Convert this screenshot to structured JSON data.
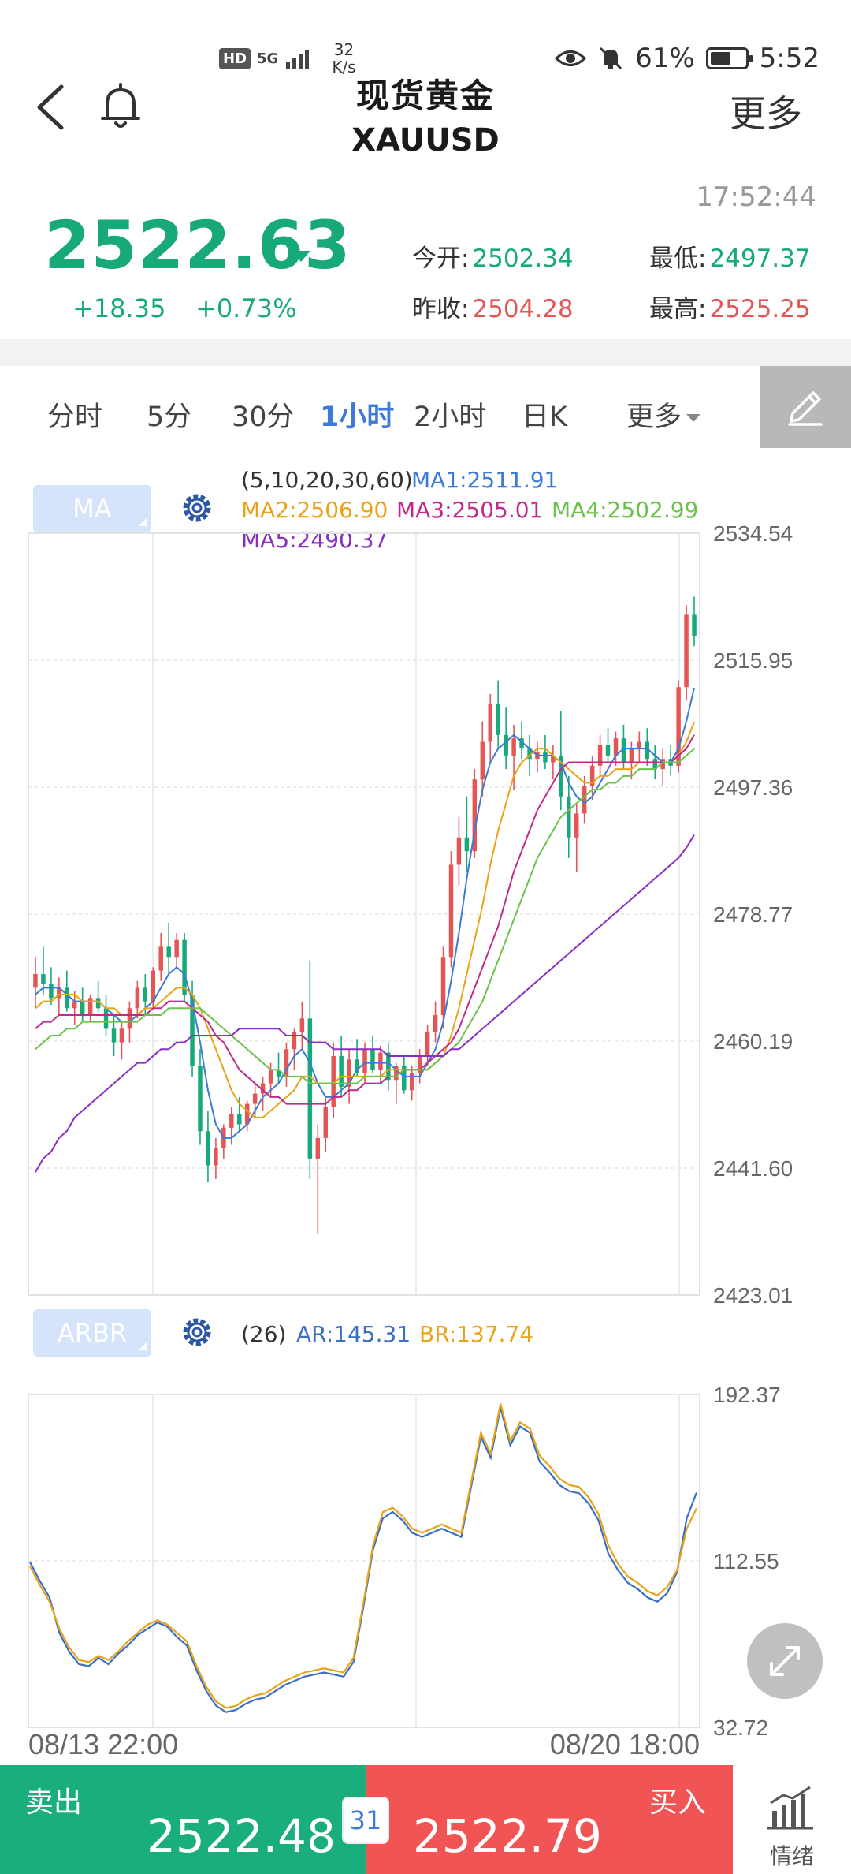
{
  "status_bar": {
    "hd": "HD",
    "network": "5G",
    "speed_value": "32",
    "speed_unit": "K/s",
    "battery": "61%",
    "battery_level": 0.61,
    "clock": "5:52"
  },
  "header": {
    "title": "现货黄金",
    "symbol": "XAUUSD",
    "more_label": "更多"
  },
  "quote": {
    "time": "17:52:44",
    "price": "2522.63",
    "change": "+18.35",
    "change_pct": "+0.73%",
    "open_label": "今开:",
    "open": "2502.34",
    "prev_close_label": "昨收:",
    "prev_close": "2504.28",
    "low_label": "最低:",
    "low": "2497.37",
    "high_label": "最高:",
    "high": "2525.25"
  },
  "tabs": [
    {
      "label": "分时",
      "active": false
    },
    {
      "label": "5分",
      "active": false
    },
    {
      "label": "30分",
      "active": false
    },
    {
      "label": "1小时",
      "active": true
    },
    {
      "label": "2小时",
      "active": false
    },
    {
      "label": "日K",
      "active": false
    },
    {
      "label": "更多",
      "active": false
    }
  ],
  "ma_panel": {
    "button": "MA",
    "params": "(5,10,20,30,60)",
    "ma1": "MA1:2511.91",
    "ma2": "MA2:2506.90",
    "ma3": "MA3:2505.01",
    "ma4": "MA4:2502.99",
    "ma5": "MA5:2490.37"
  },
  "arbr_panel": {
    "button": "ARBR",
    "params": "(26)",
    "ar": "AR:145.31",
    "br": "BR:137.74"
  },
  "x_labels": {
    "start": "08/13 22:00",
    "end": "08/20 18:00"
  },
  "trade": {
    "sell_label": "卖出",
    "sell_price": "2522.48",
    "spread": "31",
    "buy_label": "买入",
    "buy_price": "2522.79",
    "mood_label": "情绪"
  },
  "colors": {
    "up": "#e45555",
    "down": "#17a97a",
    "ma1": "#3b7ad6",
    "ma2": "#e8a317",
    "ma3": "#c2298a",
    "ma4": "#6cc24a",
    "ma5": "#8a2ec2",
    "ar": "#3b6fc4",
    "br": "#e8a317",
    "accent": "#3b7ad6"
  },
  "chart_data": [
    {
      "type": "candlestick",
      "title": "",
      "y_ticks": [
        "2534.54",
        "2515.95",
        "2497.36",
        "2478.77",
        "2460.19",
        "2441.60",
        "2423.01"
      ],
      "ylim": [
        2423.01,
        2534.54
      ],
      "grid": true,
      "candles": [
        [
          2468.0,
          2472.5,
          2465.0,
          2470.0
        ],
        [
          2470.0,
          2474.0,
          2467.0,
          2468.5
        ],
        [
          2468.5,
          2471.0,
          2465.5,
          2466.5
        ],
        [
          2466.5,
          2469.5,
          2464.0,
          2468.0
        ],
        [
          2468.0,
          2470.5,
          2464.5,
          2465.0
        ],
        [
          2465.0,
          2467.5,
          2462.5,
          2466.0
        ],
        [
          2466.0,
          2468.0,
          2463.0,
          2464.0
        ],
        [
          2464.0,
          2467.0,
          2463.0,
          2466.5
        ],
        [
          2466.5,
          2469.0,
          2464.5,
          2465.0
        ],
        [
          2465.0,
          2467.0,
          2461.0,
          2462.0
        ],
        [
          2462.0,
          2464.0,
          2458.0,
          2460.0
        ],
        [
          2460.0,
          2463.0,
          2457.5,
          2462.0
        ],
        [
          2462.0,
          2466.0,
          2460.0,
          2465.0
        ],
        [
          2465.0,
          2469.0,
          2463.5,
          2468.0
        ],
        [
          2468.0,
          2470.0,
          2464.0,
          2466.0
        ],
        [
          2466.0,
          2471.0,
          2465.0,
          2470.5
        ],
        [
          2470.5,
          2476.0,
          2469.0,
          2474.0
        ],
        [
          2474.0,
          2477.5,
          2470.0,
          2472.5
        ],
        [
          2472.5,
          2476.0,
          2471.0,
          2475.0
        ],
        [
          2475.0,
          2476.0,
          2466.0,
          2467.0
        ],
        [
          2467.0,
          2469.0,
          2455.0,
          2456.5
        ],
        [
          2456.5,
          2459.0,
          2445.0,
          2447.0
        ],
        [
          2447.0,
          2450.0,
          2439.5,
          2442.0
        ],
        [
          2442.0,
          2446.0,
          2440.0,
          2444.5
        ],
        [
          2444.5,
          2448.0,
          2443.0,
          2447.5
        ],
        [
          2447.5,
          2450.5,
          2445.0,
          2449.5
        ],
        [
          2449.5,
          2452.0,
          2447.0,
          2448.0
        ],
        [
          2448.0,
          2451.5,
          2447.0,
          2451.0
        ],
        [
          2451.0,
          2454.0,
          2449.0,
          2452.5
        ],
        [
          2452.5,
          2455.0,
          2450.0,
          2454.0
        ],
        [
          2454.0,
          2457.0,
          2452.0,
          2456.0
        ],
        [
          2456.0,
          2458.5,
          2454.0,
          2455.0
        ],
        [
          2455.0,
          2460.0,
          2453.5,
          2459.0
        ],
        [
          2459.0,
          2462.0,
          2456.0,
          2461.5
        ],
        [
          2461.5,
          2466.0,
          2459.0,
          2463.5
        ],
        [
          2463.5,
          2472.0,
          2440.0,
          2443.0
        ],
        [
          2443.0,
          2448.0,
          2432.0,
          2446.0
        ],
        [
          2446.0,
          2452.0,
          2444.0,
          2450.5
        ],
        [
          2450.5,
          2460.0,
          2449.0,
          2458.0
        ],
        [
          2458.0,
          2461.0,
          2452.0,
          2453.5
        ],
        [
          2453.5,
          2459.0,
          2451.0,
          2457.5
        ],
        [
          2457.5,
          2460.5,
          2455.0,
          2455.5
        ],
        [
          2455.5,
          2460.0,
          2454.0,
          2459.0
        ],
        [
          2459.0,
          2461.0,
          2455.5,
          2456.0
        ],
        [
          2456.0,
          2459.5,
          2454.0,
          2458.5
        ],
        [
          2458.5,
          2460.0,
          2453.0,
          2454.5
        ],
        [
          2454.5,
          2457.0,
          2451.0,
          2456.5
        ],
        [
          2456.5,
          2458.0,
          2452.5,
          2453.0
        ],
        [
          2453.0,
          2456.5,
          2451.5,
          2455.5
        ],
        [
          2455.5,
          2459.0,
          2454.0,
          2458.0
        ],
        [
          2458.0,
          2462.5,
          2456.5,
          2461.5
        ],
        [
          2461.5,
          2466.0,
          2460.0,
          2464.0
        ],
        [
          2464.0,
          2474.0,
          2462.0,
          2472.5
        ],
        [
          2472.5,
          2488.0,
          2471.0,
          2486.0
        ],
        [
          2486.0,
          2493.0,
          2483.0,
          2490.0
        ],
        [
          2490.0,
          2496.0,
          2485.0,
          2488.0
        ],
        [
          2488.0,
          2500.0,
          2487.0,
          2498.5
        ],
        [
          2498.5,
          2507.0,
          2496.0,
          2504.0
        ],
        [
          2504.0,
          2511.0,
          2501.0,
          2509.5
        ],
        [
          2509.5,
          2513.0,
          2503.0,
          2505.0
        ],
        [
          2505.0,
          2509.0,
          2500.0,
          2502.0
        ],
        [
          2502.0,
          2506.5,
          2497.0,
          2504.5
        ],
        [
          2504.5,
          2507.0,
          2501.5,
          2503.0
        ],
        [
          2503.0,
          2505.0,
          2499.0,
          2501.5
        ],
        [
          2501.5,
          2504.0,
          2499.5,
          2502.5
        ],
        [
          2502.5,
          2505.0,
          2500.0,
          2501.0
        ],
        [
          2501.0,
          2503.5,
          2498.5,
          2502.0
        ],
        [
          2502.0,
          2508.5,
          2494.0,
          2496.0
        ],
        [
          2496.0,
          2499.0,
          2487.0,
          2490.0
        ],
        [
          2490.0,
          2495.0,
          2485.0,
          2493.5
        ],
        [
          2493.5,
          2499.0,
          2492.0,
          2497.5
        ],
        [
          2497.5,
          2502.0,
          2495.5,
          2500.5
        ],
        [
          2500.5,
          2505.0,
          2499.0,
          2503.5
        ],
        [
          2503.5,
          2506.0,
          2501.0,
          2502.0
        ],
        [
          2502.0,
          2505.5,
          2500.5,
          2504.5
        ],
        [
          2504.5,
          2506.5,
          2500.0,
          2501.0
        ],
        [
          2501.0,
          2504.0,
          2498.5,
          2503.0
        ],
        [
          2503.0,
          2505.5,
          2501.0,
          2504.0
        ],
        [
          2504.0,
          2506.0,
          2500.5,
          2501.5
        ],
        [
          2501.5,
          2503.5,
          2498.5,
          2500.0
        ],
        [
          2500.0,
          2503.0,
          2497.5,
          2501.5
        ],
        [
          2501.5,
          2503.5,
          2499.0,
          2500.5
        ],
        [
          2500.5,
          2513.0,
          2499.5,
          2512.0
        ],
        [
          2512.0,
          2524.0,
          2510.0,
          2522.6
        ],
        [
          2522.6,
          2525.25,
          2518.0,
          2519.5
        ]
      ],
      "ma_lines": {
        "MA1": [
          2467,
          2468,
          2468,
          2468,
          2467,
          2466,
          2466,
          2466,
          2466,
          2465,
          2464,
          2463,
          2463,
          2464,
          2465,
          2466,
          2468,
          2470,
          2471,
          2470,
          2466,
          2460,
          2453,
          2448,
          2446,
          2446,
          2447,
          2448,
          2450,
          2452,
          2453,
          2454,
          2456,
          2458,
          2459,
          2457,
          2454,
          2452,
          2452,
          2453,
          2454,
          2456,
          2457,
          2457,
          2457,
          2457,
          2456,
          2455,
          2455,
          2455,
          2457,
          2459,
          2463,
          2469,
          2476,
          2484,
          2491,
          2497,
          2501,
          2503,
          2504,
          2505,
          2504,
          2503,
          2502,
          2502,
          2502,
          2501,
          2498,
          2496,
          2495,
          2496,
          2498,
          2500,
          2502,
          2503,
          2503,
          2503,
          2503,
          2502,
          2501,
          2501,
          2503,
          2507,
          2511.91
        ],
        "MA2": [
          2465,
          2466,
          2466,
          2467,
          2467,
          2467,
          2466,
          2466,
          2466,
          2465,
          2465,
          2464,
          2464,
          2464,
          2465,
          2465,
          2466,
          2467,
          2468,
          2468,
          2467,
          2465,
          2462,
          2459,
          2456,
          2453,
          2451,
          2450,
          2449,
          2449,
          2450,
          2451,
          2452,
          2453,
          2455,
          2455,
          2454,
          2454,
          2454,
          2455,
          2455,
          2455,
          2455,
          2455,
          2455,
          2456,
          2456,
          2456,
          2456,
          2456,
          2456,
          2457,
          2458,
          2461,
          2465,
          2470,
          2475,
          2480,
          2486,
          2491,
          2495,
          2499,
          2501,
          2502,
          2503,
          2503,
          2502,
          2501,
          2500,
          2499,
          2498,
          2498,
          2499,
          2499,
          2500,
          2500,
          2500,
          2501,
          2501,
          2501,
          2501,
          2501,
          2502,
          2504,
          2506.9
        ],
        "MA3": [
          2462,
          2463,
          2463,
          2464,
          2464,
          2464,
          2464,
          2464,
          2464,
          2464,
          2464,
          2464,
          2464,
          2464,
          2464,
          2465,
          2465,
          2466,
          2466,
          2466,
          2465,
          2464,
          2463,
          2461,
          2460,
          2458,
          2456,
          2455,
          2454,
          2453,
          2452,
          2452,
          2451,
          2451,
          2451,
          2451,
          2451,
          2451,
          2452,
          2452,
          2453,
          2453,
          2454,
          2454,
          2454,
          2455,
          2455,
          2456,
          2456,
          2456,
          2457,
          2458,
          2459,
          2460,
          2462,
          2465,
          2468,
          2471,
          2474,
          2477,
          2481,
          2485,
          2488,
          2491,
          2494,
          2496,
          2498,
          2500,
          2501,
          2501,
          2501,
          2501,
          2501,
          2501,
          2501,
          2501,
          2501,
          2501,
          2501,
          2501,
          2501,
          2501,
          2502,
          2503,
          2505.01
        ],
        "MA4": [
          2459,
          2460,
          2461,
          2461,
          2462,
          2462,
          2463,
          2463,
          2463,
          2463,
          2463,
          2463,
          2463,
          2463,
          2464,
          2464,
          2464,
          2465,
          2465,
          2465,
          2465,
          2465,
          2464,
          2463,
          2462,
          2461,
          2460,
          2459,
          2458,
          2457,
          2456,
          2456,
          2455,
          2455,
          2455,
          2454,
          2454,
          2454,
          2454,
          2454,
          2454,
          2454,
          2455,
          2455,
          2455,
          2455,
          2455,
          2456,
          2456,
          2456,
          2456,
          2457,
          2458,
          2459,
          2460,
          2462,
          2464,
          2466,
          2469,
          2472,
          2475,
          2478,
          2481,
          2484,
          2487,
          2489,
          2491,
          2493,
          2494,
          2495,
          2496,
          2497,
          2497,
          2498,
          2498,
          2499,
          2499,
          2500,
          2500,
          2500,
          2501,
          2501,
          2501,
          2502,
          2502.99
        ],
        "MA5": [
          2441,
          2443,
          2444,
          2446,
          2447,
          2449,
          2450,
          2451,
          2452,
          2453,
          2454,
          2455,
          2456,
          2457,
          2457,
          2458,
          2459,
          2459,
          2460,
          2460,
          2461,
          2461,
          2461,
          2461,
          2461,
          2461,
          2462,
          2462,
          2462,
          2462,
          2462,
          2462,
          2461,
          2461,
          2461,
          2460,
          2460,
          2460,
          2459,
          2459,
          2459,
          2459,
          2459,
          2459,
          2459,
          2458,
          2458,
          2458,
          2458,
          2458,
          2458,
          2458,
          2458,
          2459,
          2459,
          2460,
          2461,
          2462,
          2463,
          2464,
          2465,
          2466,
          2467,
          2468,
          2469,
          2470,
          2471,
          2472,
          2473,
          2474,
          2475,
          2476,
          2477,
          2478,
          2479,
          2480,
          2481,
          2482,
          2483,
          2484,
          2485,
          2486,
          2487,
          2488.5,
          2490.37
        ]
      }
    },
    {
      "type": "line",
      "title": "",
      "y_ticks": [
        "192.37",
        "112.55",
        "32.72"
      ],
      "ylim": [
        32.72,
        192.37
      ],
      "x_ticks": [
        "08/13 22:00",
        "08/20 18:00"
      ],
      "series": [
        {
          "name": "AR",
          "values": [
            112,
            103,
            95,
            78,
            69,
            63,
            62,
            66,
            63,
            68,
            72,
            77,
            80,
            83,
            81,
            76,
            72,
            60,
            50,
            43,
            40,
            41,
            44,
            46,
            47,
            50,
            53,
            55,
            57,
            58,
            59,
            58,
            57,
            64,
            90,
            118,
            133,
            136,
            132,
            126,
            124,
            126,
            128,
            126,
            124,
            148,
            172,
            162,
            186,
            168,
            177,
            174,
            160,
            155,
            149,
            146,
            145,
            140,
            132,
            116,
            108,
            102,
            99,
            95,
            93,
            97,
            107,
            133,
            145.31
          ]
        },
        {
          "name": "BR",
          "values": [
            110,
            101,
            93,
            80,
            71,
            65,
            64,
            67,
            65,
            69,
            74,
            78,
            82,
            84,
            82,
            78,
            74,
            62,
            52,
            45,
            42,
            43,
            46,
            48,
            49,
            52,
            55,
            57,
            59,
            60,
            61,
            60,
            59,
            66,
            92,
            120,
            136,
            138,
            134,
            128,
            126,
            128,
            130,
            128,
            126,
            150,
            174,
            164,
            188,
            170,
            179,
            176,
            163,
            158,
            152,
            149,
            148,
            143,
            135,
            120,
            111,
            105,
            102,
            98,
            96,
            100,
            108,
            128,
            137.74
          ]
        }
      ]
    }
  ]
}
